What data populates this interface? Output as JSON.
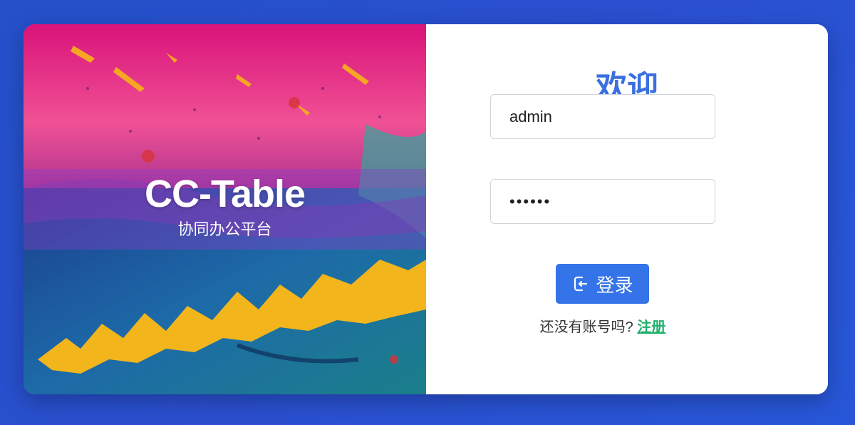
{
  "hero": {
    "title": "CC-Table",
    "subtitle": "协同办公平台"
  },
  "login": {
    "welcome": "欢迎",
    "username_value": "admin",
    "password_value": "••••••",
    "login_button_label": "登录",
    "login_icon": "sign-in-icon",
    "register_prompt": "还没有账号吗?",
    "register_link": "注册"
  },
  "colors": {
    "background": "#2a4fcf",
    "accent": "#3473e8",
    "welcome_text": "#3a6fe0",
    "register_link": "#1fb06a"
  }
}
